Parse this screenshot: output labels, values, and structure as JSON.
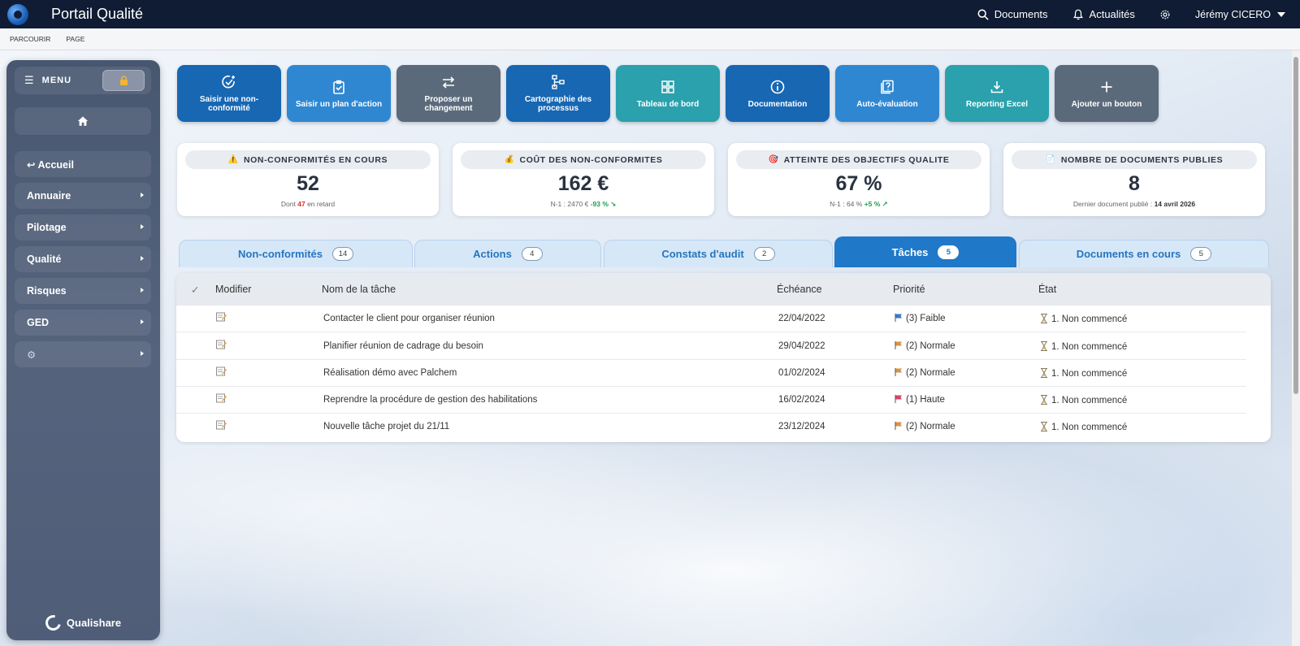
{
  "header": {
    "app_title": "Portail Qualité",
    "documents_label": "Documents",
    "news_label": "Actualités",
    "user_name": "Jérémy CICERO"
  },
  "subbar": {
    "parcourir": "PARCOURIR",
    "page": "PAGE"
  },
  "sidebar": {
    "menu_label": "MENU",
    "items": [
      {
        "label": "↩ Accueil",
        "submenu": false
      },
      {
        "label": "Annuaire",
        "submenu": true
      },
      {
        "label": "Pilotage",
        "submenu": true
      },
      {
        "label": "Qualité",
        "submenu": true
      },
      {
        "label": "Risques",
        "submenu": true
      },
      {
        "label": "GED",
        "submenu": true
      },
      {
        "label": "⚙",
        "submenu": true
      }
    ],
    "brand": "Qualishare"
  },
  "quick_buttons": [
    {
      "label": "Saisir une non-conformité",
      "icon": "check-plus-icon",
      "color": "#1767b3"
    },
    {
      "label": "Saisir un plan d'action",
      "icon": "clipboard-check-icon",
      "color": "#2f87d1"
    },
    {
      "label": "Proposer un changement",
      "icon": "swap-arrows-icon",
      "color": "#5b6a7b"
    },
    {
      "label": "Cartographie des processus",
      "icon": "process-map-icon",
      "color": "#1767b3"
    },
    {
      "label": "Tableau de bord",
      "icon": "dashboard-icon",
      "color": "#2aa1ad"
    },
    {
      "label": "Documentation",
      "icon": "info-icon",
      "color": "#1767b3"
    },
    {
      "label": "Auto-évaluation",
      "icon": "question-doc-icon",
      "color": "#2f87d1"
    },
    {
      "label": "Reporting Excel",
      "icon": "download-icon",
      "color": "#2aa1ad"
    },
    {
      "label": "Ajouter un bouton",
      "icon": "plus-icon",
      "color": "#5b6a7b"
    }
  ],
  "kpis": [
    {
      "icon": "⚠️",
      "title": "NON-CONFORMITÉS EN COURS",
      "value": "52",
      "sub_pre": "Dont",
      "sub_highlight": "47",
      "sub_post": "en retard"
    },
    {
      "icon": "💰",
      "title": "COÛT DES NON-CONFORMITES",
      "value": "162 €",
      "sub_pre": "N-1 : 2470 €",
      "sub_highlight": "-93 % ↘",
      "sub_post": ""
    },
    {
      "icon": "🎯",
      "title": "ATTEINTE DES OBJECTIFS QUALITE",
      "value": "67 %",
      "sub_pre": "N-1 : 64 %",
      "sub_highlight": "+5 % ↗",
      "sub_post": ""
    },
    {
      "icon": "📄",
      "title": "NOMBRE DE DOCUMENTS PUBLIES",
      "value": "8",
      "sub_pre": "Dernier document publié :",
      "sub_highlight": "14 avril 2026",
      "sub_post": ""
    }
  ],
  "tabs": [
    {
      "label": "Non-conformités",
      "count": "14",
      "active": false
    },
    {
      "label": "Actions",
      "count": "4",
      "active": false
    },
    {
      "label": "Constats d'audit",
      "count": "2",
      "active": false
    },
    {
      "label": "Tâches",
      "count": "5",
      "active": true
    },
    {
      "label": "Documents en cours",
      "count": "5",
      "active": false
    }
  ],
  "table": {
    "columns": [
      "✓",
      "Modifier",
      "Nom de la tâche",
      "Échéance",
      "Priorité",
      "État"
    ],
    "rows": [
      {
        "name": "Contacter le client pour organiser réunion",
        "due": "22/04/2022",
        "priority": "(3) Faible",
        "priority_color": "#3b78c9",
        "state": "1. Non commencé"
      },
      {
        "name": "Planifier réunion de cadrage du besoin",
        "due": "29/04/2022",
        "priority": "(2) Normale",
        "priority_color": "#d9934a",
        "state": "1. Non commencé"
      },
      {
        "name": "Réalisation démo avec Palchem",
        "due": "01/02/2024",
        "priority": "(2) Normale",
        "priority_color": "#d9934a",
        "state": "1. Non commencé"
      },
      {
        "name": "Reprendre la procédure de gestion des habilitations",
        "due": "16/02/2024",
        "priority": "(1) Haute",
        "priority_color": "#d6456a",
        "state": "1. Non commencé"
      },
      {
        "name": "Nouvelle tâche projet du 21/11",
        "due": "23/12/2024",
        "priority": "(2) Normale",
        "priority_color": "#d9934a",
        "state": "1. Non commencé"
      }
    ]
  }
}
